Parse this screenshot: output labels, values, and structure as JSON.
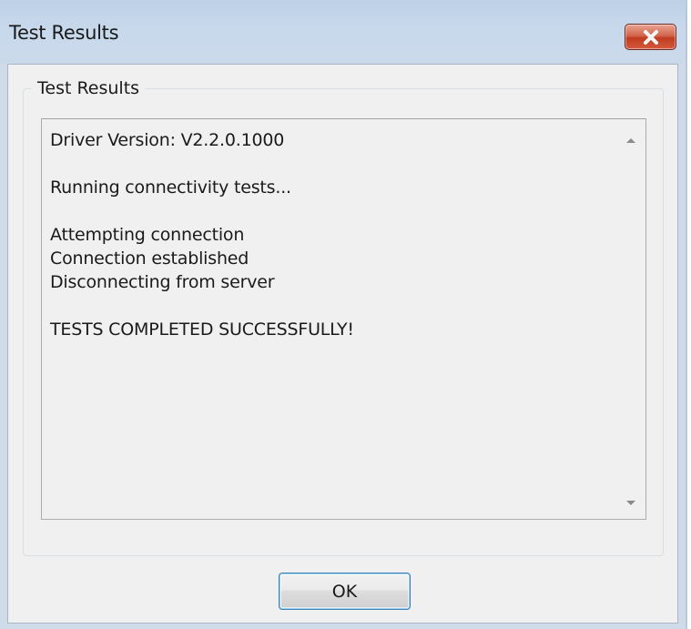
{
  "window": {
    "title": "Test Results",
    "close_icon": "close-icon"
  },
  "group": {
    "legend": "Test Results"
  },
  "results": {
    "lines": [
      "Driver Version: V2.2.0.1000",
      "",
      "Running connectivity tests...",
      "",
      "Attempting connection",
      "Connection established",
      "Disconnecting from server",
      "",
      "TESTS COMPLETED SUCCESSFULLY!"
    ]
  },
  "scrollbar": {
    "up_icon": "scroll-up-arrow-icon",
    "down_icon": "scroll-down-arrow-icon"
  },
  "buttons": {
    "ok_label": "OK"
  },
  "colors": {
    "titlebar": "#c9d9ec",
    "close_button": "#c13c21",
    "client_background": "#f0f0f0",
    "ok_button_border": "#3c7fb1"
  }
}
